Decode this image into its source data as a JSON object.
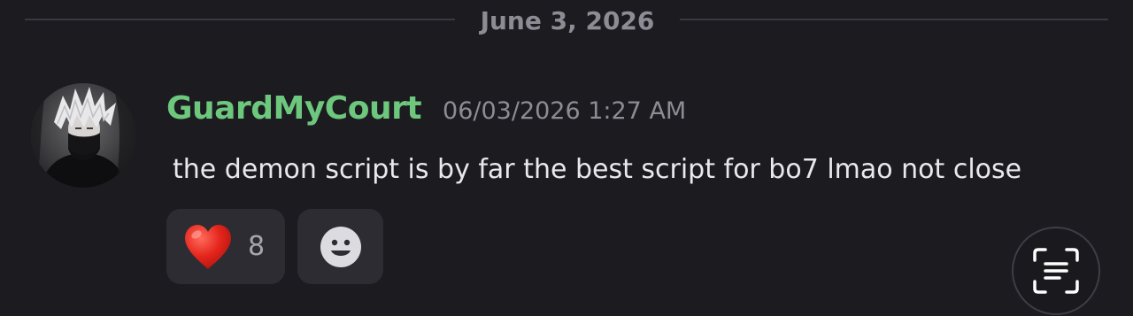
{
  "divider": {
    "date": "June 3, 2026"
  },
  "message": {
    "username": "GuardMyCourt",
    "username_color": "#6dc77d",
    "timestamp": "06/03/2026 1:27 AM",
    "text": "the demon script is by far the best script for bo7 lmao not close",
    "avatar_icon": "avatar-anime-character"
  },
  "reactions": [
    {
      "emoji": "❤️",
      "icon": "red-heart-icon",
      "count": "8"
    },
    {
      "icon": "add-reaction-smiley-icon"
    }
  ],
  "floating_button": {
    "icon": "text-scan-icon"
  }
}
